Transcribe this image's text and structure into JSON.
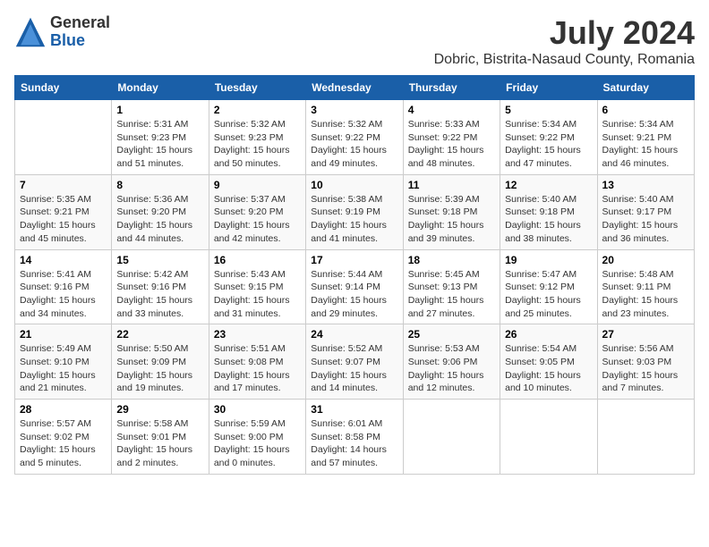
{
  "logo": {
    "general": "General",
    "blue": "Blue"
  },
  "title": "July 2024",
  "subtitle": "Dobric, Bistrita-Nasaud County, Romania",
  "days_of_week": [
    "Sunday",
    "Monday",
    "Tuesday",
    "Wednesday",
    "Thursday",
    "Friday",
    "Saturday"
  ],
  "weeks": [
    [
      {
        "day": "",
        "info": ""
      },
      {
        "day": "1",
        "info": "Sunrise: 5:31 AM\nSunset: 9:23 PM\nDaylight: 15 hours\nand 51 minutes."
      },
      {
        "day": "2",
        "info": "Sunrise: 5:32 AM\nSunset: 9:23 PM\nDaylight: 15 hours\nand 50 minutes."
      },
      {
        "day": "3",
        "info": "Sunrise: 5:32 AM\nSunset: 9:22 PM\nDaylight: 15 hours\nand 49 minutes."
      },
      {
        "day": "4",
        "info": "Sunrise: 5:33 AM\nSunset: 9:22 PM\nDaylight: 15 hours\nand 48 minutes."
      },
      {
        "day": "5",
        "info": "Sunrise: 5:34 AM\nSunset: 9:22 PM\nDaylight: 15 hours\nand 47 minutes."
      },
      {
        "day": "6",
        "info": "Sunrise: 5:34 AM\nSunset: 9:21 PM\nDaylight: 15 hours\nand 46 minutes."
      }
    ],
    [
      {
        "day": "7",
        "info": "Sunrise: 5:35 AM\nSunset: 9:21 PM\nDaylight: 15 hours\nand 45 minutes."
      },
      {
        "day": "8",
        "info": "Sunrise: 5:36 AM\nSunset: 9:20 PM\nDaylight: 15 hours\nand 44 minutes."
      },
      {
        "day": "9",
        "info": "Sunrise: 5:37 AM\nSunset: 9:20 PM\nDaylight: 15 hours\nand 42 minutes."
      },
      {
        "day": "10",
        "info": "Sunrise: 5:38 AM\nSunset: 9:19 PM\nDaylight: 15 hours\nand 41 minutes."
      },
      {
        "day": "11",
        "info": "Sunrise: 5:39 AM\nSunset: 9:18 PM\nDaylight: 15 hours\nand 39 minutes."
      },
      {
        "day": "12",
        "info": "Sunrise: 5:40 AM\nSunset: 9:18 PM\nDaylight: 15 hours\nand 38 minutes."
      },
      {
        "day": "13",
        "info": "Sunrise: 5:40 AM\nSunset: 9:17 PM\nDaylight: 15 hours\nand 36 minutes."
      }
    ],
    [
      {
        "day": "14",
        "info": "Sunrise: 5:41 AM\nSunset: 9:16 PM\nDaylight: 15 hours\nand 34 minutes."
      },
      {
        "day": "15",
        "info": "Sunrise: 5:42 AM\nSunset: 9:16 PM\nDaylight: 15 hours\nand 33 minutes."
      },
      {
        "day": "16",
        "info": "Sunrise: 5:43 AM\nSunset: 9:15 PM\nDaylight: 15 hours\nand 31 minutes."
      },
      {
        "day": "17",
        "info": "Sunrise: 5:44 AM\nSunset: 9:14 PM\nDaylight: 15 hours\nand 29 minutes."
      },
      {
        "day": "18",
        "info": "Sunrise: 5:45 AM\nSunset: 9:13 PM\nDaylight: 15 hours\nand 27 minutes."
      },
      {
        "day": "19",
        "info": "Sunrise: 5:47 AM\nSunset: 9:12 PM\nDaylight: 15 hours\nand 25 minutes."
      },
      {
        "day": "20",
        "info": "Sunrise: 5:48 AM\nSunset: 9:11 PM\nDaylight: 15 hours\nand 23 minutes."
      }
    ],
    [
      {
        "day": "21",
        "info": "Sunrise: 5:49 AM\nSunset: 9:10 PM\nDaylight: 15 hours\nand 21 minutes."
      },
      {
        "day": "22",
        "info": "Sunrise: 5:50 AM\nSunset: 9:09 PM\nDaylight: 15 hours\nand 19 minutes."
      },
      {
        "day": "23",
        "info": "Sunrise: 5:51 AM\nSunset: 9:08 PM\nDaylight: 15 hours\nand 17 minutes."
      },
      {
        "day": "24",
        "info": "Sunrise: 5:52 AM\nSunset: 9:07 PM\nDaylight: 15 hours\nand 14 minutes."
      },
      {
        "day": "25",
        "info": "Sunrise: 5:53 AM\nSunset: 9:06 PM\nDaylight: 15 hours\nand 12 minutes."
      },
      {
        "day": "26",
        "info": "Sunrise: 5:54 AM\nSunset: 9:05 PM\nDaylight: 15 hours\nand 10 minutes."
      },
      {
        "day": "27",
        "info": "Sunrise: 5:56 AM\nSunset: 9:03 PM\nDaylight: 15 hours\nand 7 minutes."
      }
    ],
    [
      {
        "day": "28",
        "info": "Sunrise: 5:57 AM\nSunset: 9:02 PM\nDaylight: 15 hours\nand 5 minutes."
      },
      {
        "day": "29",
        "info": "Sunrise: 5:58 AM\nSunset: 9:01 PM\nDaylight: 15 hours\nand 2 minutes."
      },
      {
        "day": "30",
        "info": "Sunrise: 5:59 AM\nSunset: 9:00 PM\nDaylight: 15 hours\nand 0 minutes."
      },
      {
        "day": "31",
        "info": "Sunrise: 6:01 AM\nSunset: 8:58 PM\nDaylight: 14 hours\nand 57 minutes."
      },
      {
        "day": "",
        "info": ""
      },
      {
        "day": "",
        "info": ""
      },
      {
        "day": "",
        "info": ""
      }
    ]
  ]
}
